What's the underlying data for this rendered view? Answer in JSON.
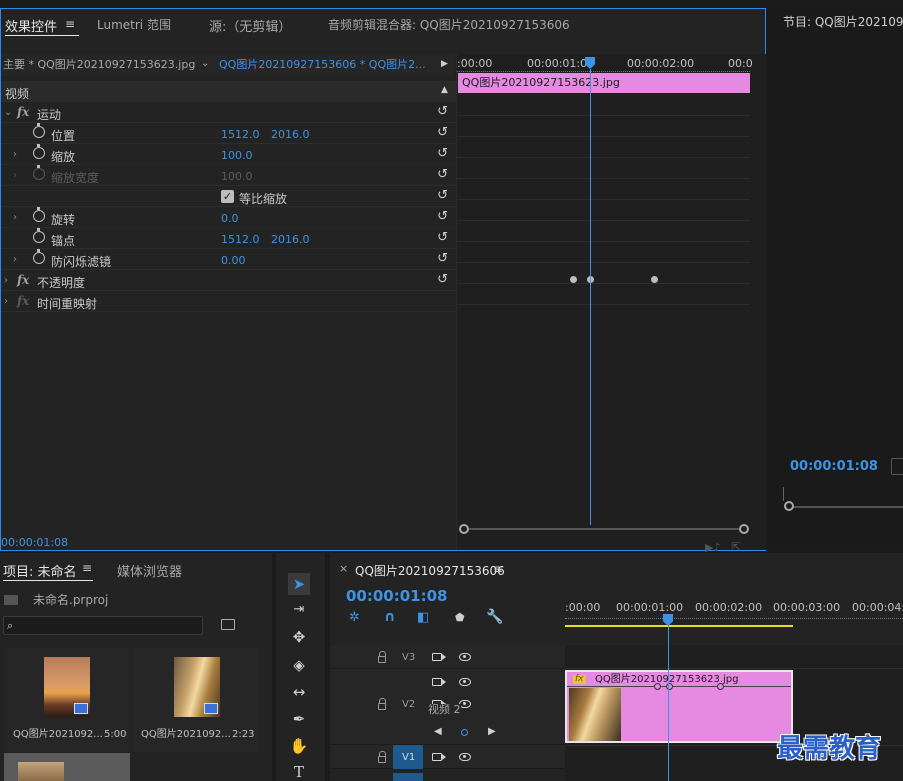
{
  "effect_controls": {
    "tabs": [
      "效果控件",
      "Lumetri 范围",
      "源:（无剪辑）",
      "音频剪辑混合器: QQ图片20210927153606"
    ],
    "source_label": "主要 * QQ图片20210927153623.jpg",
    "sequence_label": "QQ图片20210927153606 * QQ图片2...",
    "section_video": "视频",
    "motion": "运动",
    "position_label": "位置",
    "position_x": "1512.0",
    "position_y": "2016.0",
    "scale_label": "缩放",
    "scale_value": "100.0",
    "scale_width_label": "缩放宽度",
    "scale_width_value": "100.0",
    "uniform_scale_label": "等比缩放",
    "rotation_label": "旋转",
    "rotation_value": "0.0",
    "anchor_label": "锚点",
    "anchor_x": "1512.0",
    "anchor_y": "2016.0",
    "anti_flicker_label": "防闪烁滤镜",
    "anti_flicker_value": "0.00",
    "opacity_label": "不透明度",
    "time_remap_label": "时间重映射",
    "timecode": "00:00:01:08",
    "ruler": [
      ":00:00",
      "00:00:01:00",
      "00:00:02:00",
      "00:0"
    ],
    "clip_name": "QQ图片20210927153623.jpg"
  },
  "program_monitor": {
    "title": "节目: QQ图片2021092",
    "timecode": "00:00:01:08"
  },
  "project": {
    "tabs": [
      "项目: 未命名",
      "媒体浏览器"
    ],
    "file_name": "未命名.prproj",
    "items": [
      {
        "name": "QQ图片2021092...",
        "duration": "5:00"
      },
      {
        "name": "QQ图片2021092...",
        "duration": "2:23"
      }
    ]
  },
  "timeline": {
    "title": "QQ图片20210927153606",
    "timecode": "00:00:01:08",
    "ruler": [
      ":00:00",
      "00:00:01:00",
      "00:00:02:00",
      "00:00:03:00",
      "00:00:04:0"
    ],
    "tracks": [
      "V3",
      "V2",
      "V1"
    ],
    "v2_name": "视频 2",
    "clip_name": "QQ图片20210927153623.jpg"
  },
  "watermark": "最需教育",
  "colors": {
    "accent": "#3d93e6",
    "clip_pink": "#e58ae0"
  }
}
